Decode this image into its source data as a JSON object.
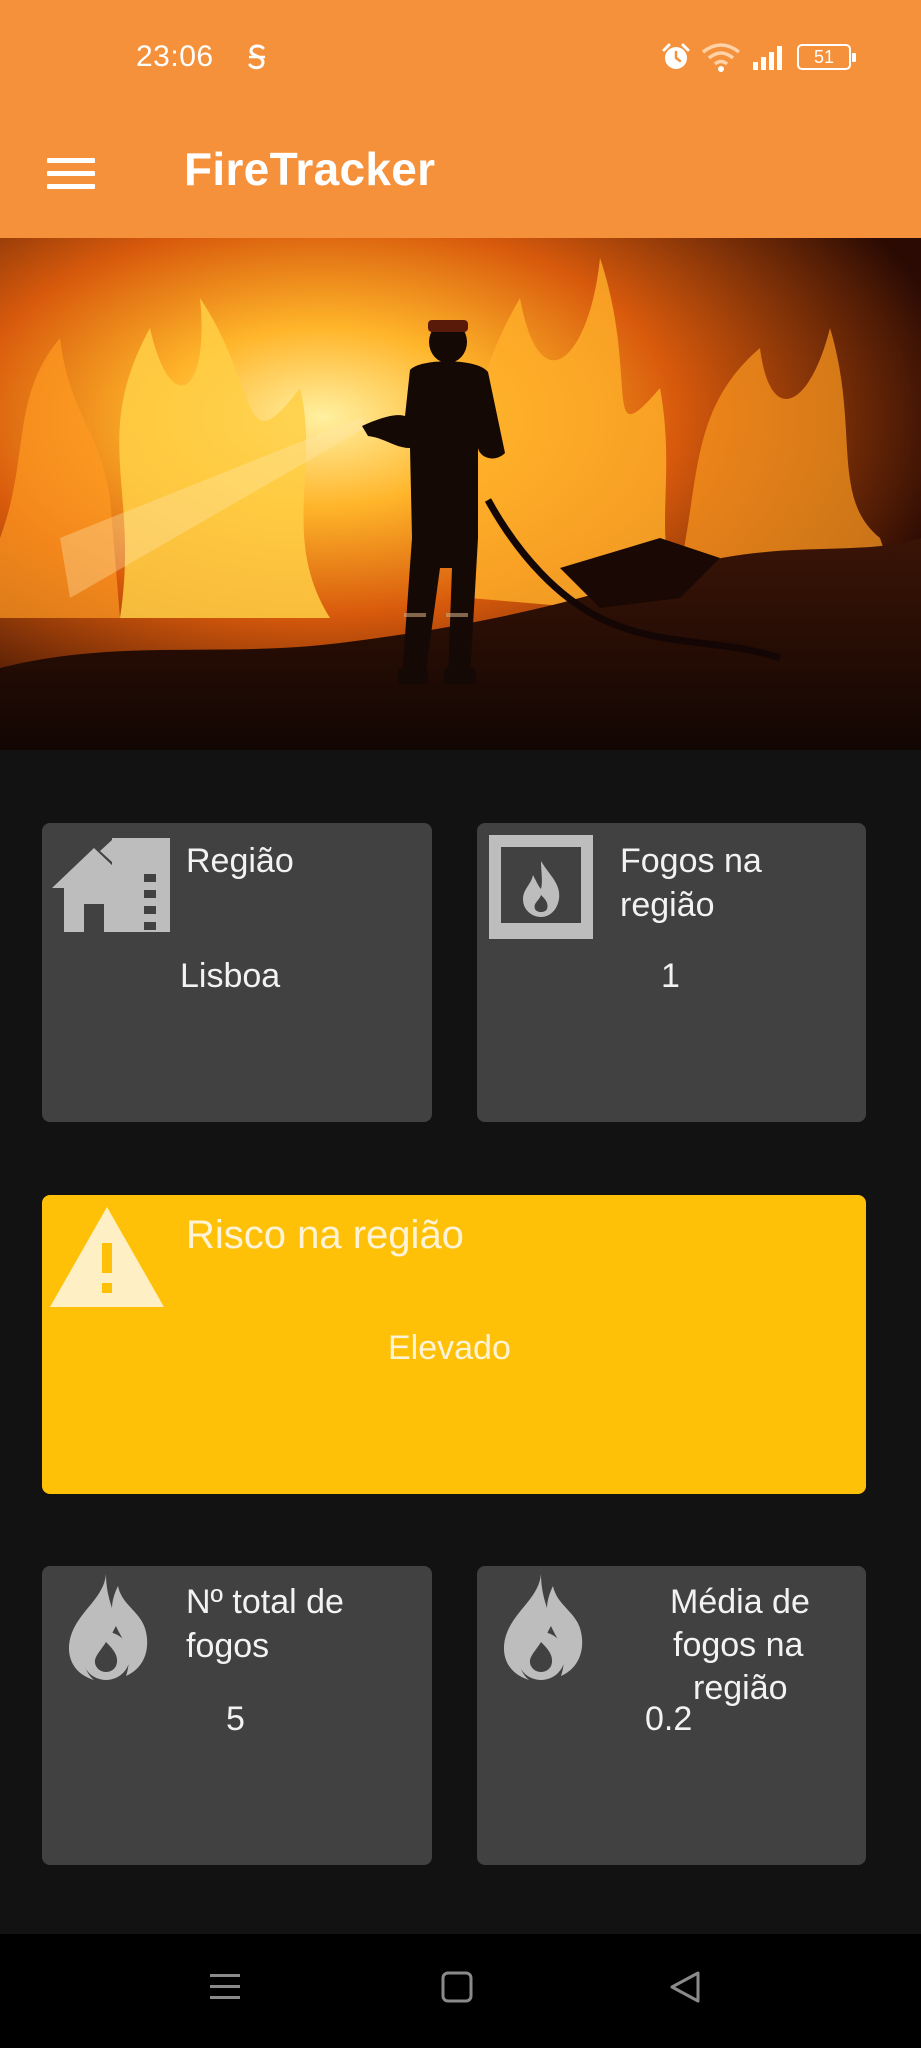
{
  "status_bar": {
    "time": "23:06",
    "battery": "51"
  },
  "app_bar": {
    "title": "FireTracker"
  },
  "cards": {
    "region": {
      "label": "Região",
      "value": "Lisboa"
    },
    "fires_in_region": {
      "label_line1": "Fogos na",
      "label_line2": "região",
      "value": "1"
    },
    "risk": {
      "label": "Risco na região",
      "value": "Elevado"
    },
    "total_fires": {
      "label_line1": "Nº total de",
      "label_line2": "fogos",
      "value": "5"
    },
    "average_fires": {
      "label_line1": "Média de",
      "label_line2": "fogos na",
      "label_line3": "região",
      "value": "0.2"
    }
  },
  "colors": {
    "app_bar": "#F6913B",
    "card": "#414141",
    "risk_card": "#FFC107",
    "background": "#121212"
  },
  "icons": [
    "menu-icon",
    "building-icon",
    "fireplace-icon",
    "warning-icon",
    "flame-icon",
    "alarm-icon",
    "wifi-icon",
    "signal-icon"
  ]
}
